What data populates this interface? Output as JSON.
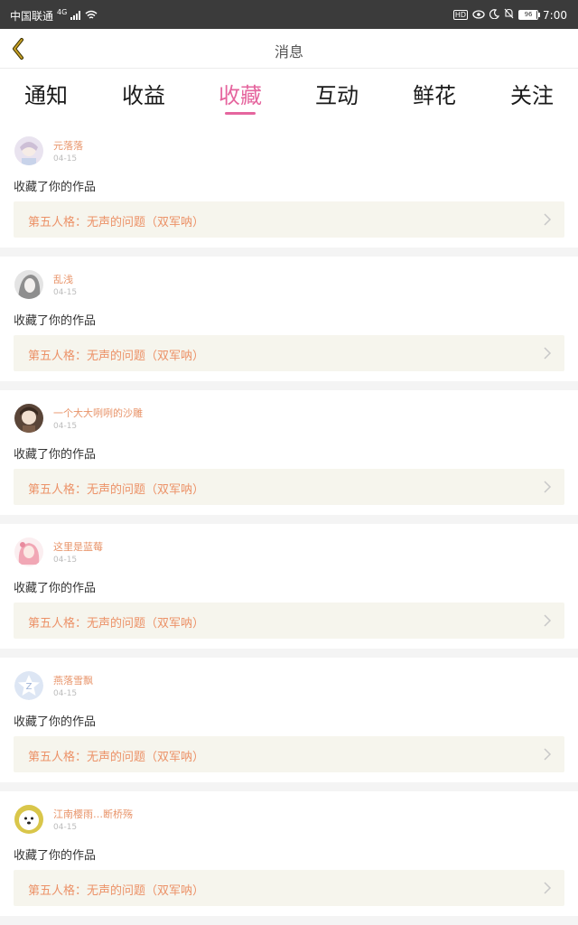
{
  "status_bar": {
    "carrier": "中国联通",
    "network": "4G",
    "time": "7:00",
    "battery": "96"
  },
  "header": {
    "back_icon": "chevron-left-icon",
    "title": "消息"
  },
  "tabs": [
    {
      "label": "通知",
      "active": false
    },
    {
      "label": "收益",
      "active": false
    },
    {
      "label": "收藏",
      "active": true
    },
    {
      "label": "互动",
      "active": false
    },
    {
      "label": "鲜花",
      "active": false
    },
    {
      "label": "关注",
      "active": false
    }
  ],
  "colors": {
    "accent": "#e5659e",
    "username": "#e8946a",
    "work_title": "#ec9268",
    "work_bg": "#f6f5ed"
  },
  "feed": [
    {
      "user": "元落落",
      "date": "04-15",
      "action": "收藏了你的作品",
      "work": "第五人格：无声的问题（双军呐）"
    },
    {
      "user": "乱浅",
      "date": "04-15",
      "action": "收藏了你的作品",
      "work": "第五人格：无声的问题（双军呐）"
    },
    {
      "user": "一个大大咧咧的沙雕",
      "date": "04-15",
      "action": "收藏了你的作品",
      "work": "第五人格：无声的问题（双军呐）"
    },
    {
      "user": "这里是蓝莓",
      "date": "04-15",
      "action": "收藏了你的作品",
      "work": "第五人格：无声的问题（双军呐）"
    },
    {
      "user": "燕落雪飘",
      "date": "04-15",
      "action": "收藏了你的作品",
      "work": "第五人格：无声的问题（双军呐）"
    },
    {
      "user": "江南樱雨…断桥殇",
      "date": "04-15",
      "action": "收藏了你的作品",
      "work": "第五人格：无声的问题（双军呐）"
    }
  ]
}
